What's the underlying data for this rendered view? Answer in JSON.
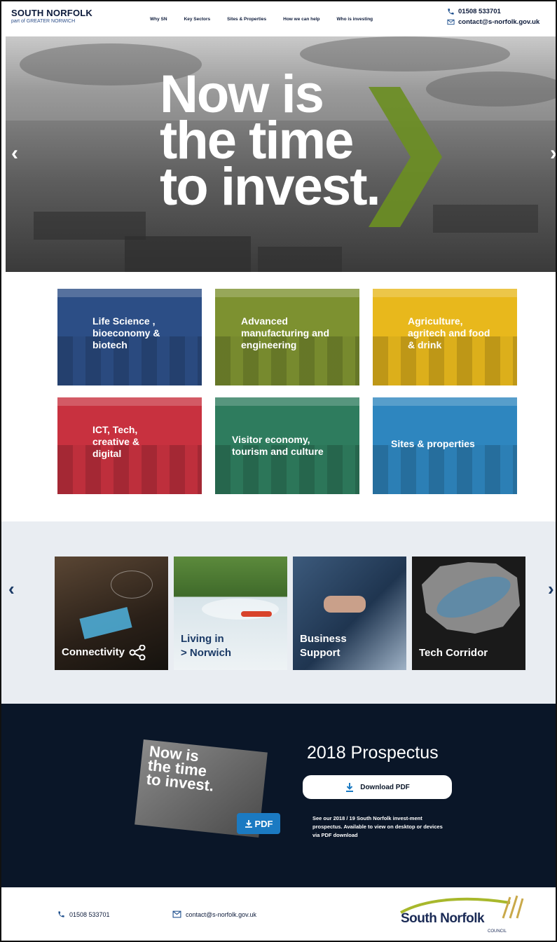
{
  "header": {
    "logo_title": "SOUTH NORFOLK",
    "logo_sub": "part of GREATER NORWICH",
    "nav": [
      "Why SN",
      "Key Sectors",
      "Sites & Properties",
      "How we can help",
      "Who is investing"
    ],
    "phone": "01508 533701",
    "email": "contact@s-norfolk.gov.uk"
  },
  "hero": {
    "line1": "Now is",
    "line2": "the time",
    "line3": "to invest.",
    "accent": "#6b8e23"
  },
  "tiles": [
    {
      "label": "Life Science , bioeconomy & biotech",
      "color": "#2c4e86"
    },
    {
      "label": "Advanced manufacturing and engineering",
      "color": "#7d9130"
    },
    {
      "label": "Agriculture, agritech and food & drink",
      "color": "#e8b81c"
    },
    {
      "label": "ICT, Tech, creative & digital",
      "color": "#c8313f"
    },
    {
      "label": "Visitor economy, tourism and culture",
      "color": "#2e7c5e"
    },
    {
      "label": "Sites & properties",
      "color": "#2e86bf"
    }
  ],
  "carousel": {
    "cards": [
      {
        "label": "Connectivity"
      },
      {
        "label_a": "Living in",
        "label_b": "> Norwich"
      },
      {
        "label_a": "Business",
        "label_b": "Support"
      },
      {
        "label": "Tech Corridor"
      }
    ]
  },
  "prospectus": {
    "title": "2018 Prospectus",
    "button": "Download PDF",
    "badge": "PDF",
    "cover_l1": "Now is",
    "cover_l2": "the time",
    "cover_l3": "to invest.",
    "description": "See our 2018 / 19 South Norfolk invest-ment prospectus. Available to view on desktop or devices via PDF download"
  },
  "footer": {
    "phone": "01508 533701",
    "email": "contact@s-norfolk.gov.uk",
    "logo_name": "South Norfolk",
    "logo_council": "COUNCIL"
  }
}
